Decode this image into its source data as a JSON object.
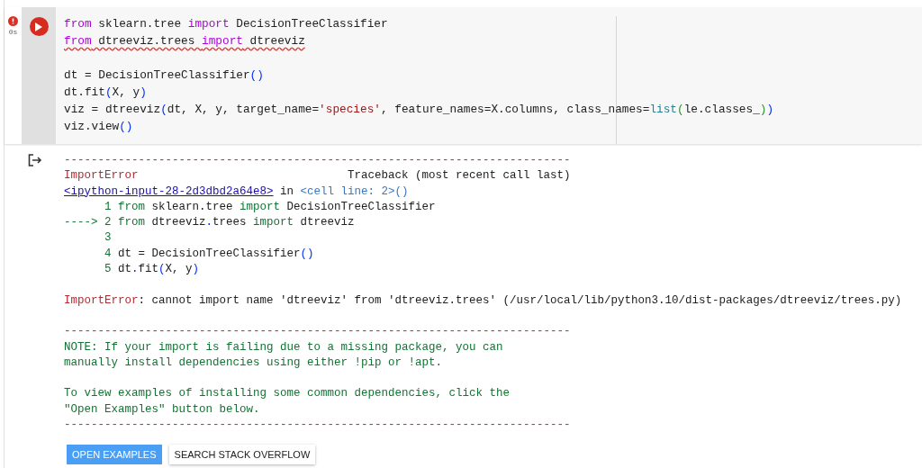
{
  "cell": {
    "error": true,
    "exec_time": "0s",
    "code_blocks": [
      [
        {
          "tokens": [
            {
              "text": "from",
              "kind": "kw"
            },
            {
              "text": " sklearn.tree ",
              "kind": "plain"
            },
            {
              "text": "import",
              "kind": "kw"
            },
            {
              "text": " DecisionTreeClassifier",
              "kind": "plain"
            }
          ],
          "error": false
        },
        {
          "error": true,
          "tokens": [
            {
              "text": "from",
              "kind": "kw"
            },
            {
              "text": " dtreeviz.trees ",
              "kind": "plain"
            },
            {
              "text": "import",
              "kind": "kw"
            },
            {
              "text": " dtreeviz",
              "kind": "plain"
            }
          ]
        }
      ],
      [
        {
          "error": false,
          "tokens": [
            {
              "text": "dt = DecisionTreeClassifier",
              "kind": "plain"
            },
            {
              "text": "()",
              "kind": "paren"
            }
          ]
        },
        {
          "error": false,
          "tokens": [
            {
              "text": "dt.fit",
              "kind": "plain"
            },
            {
              "text": "(",
              "kind": "paren"
            },
            {
              "text": "X, y",
              "kind": "plain"
            },
            {
              "text": ")",
              "kind": "paren"
            }
          ]
        },
        {
          "error": false,
          "tokens": [
            {
              "text": "viz = dtreeviz",
              "kind": "plain"
            },
            {
              "text": "(",
              "kind": "paren"
            },
            {
              "text": "dt, X, y, target_name=",
              "kind": "plain"
            },
            {
              "text": "'species'",
              "kind": "str"
            },
            {
              "text": ", feature_names=X.columns, class_names=",
              "kind": "plain"
            },
            {
              "text": "list",
              "kind": "builtin"
            },
            {
              "text": "(",
              "kind": "paren2"
            },
            {
              "text": "le.classes_",
              "kind": "plain"
            },
            {
              "text": ")",
              "kind": "paren2"
            },
            {
              "text": ")",
              "kind": "paren"
            }
          ]
        },
        {
          "error": false,
          "tokens": [
            {
              "text": "viz.view",
              "kind": "plain"
            },
            {
              "text": "()",
              "kind": "paren"
            }
          ]
        }
      ]
    ]
  },
  "output": {
    "blocks": [
      [
        [
          {
            "text": "---------------------------------------------------------------------------",
            "kind": "err"
          }
        ],
        [
          {
            "text": "ImportError",
            "kind": "err"
          },
          {
            "text": "                               Traceback (most recent call last)",
            "kind": "plain"
          }
        ],
        [
          {
            "text": "<ipython-input-28-2d3dbd2a64e8>",
            "kind": "link"
          },
          {
            "text": " in ",
            "kind": "plain"
          },
          {
            "text": "<cell line: 2>()",
            "kind": "cellref"
          }
        ],
        [
          {
            "text": "      1 ",
            "kind": "green"
          },
          {
            "text": "from",
            "kind": "green"
          },
          {
            "text": " sklearn.tree ",
            "kind": "plain"
          },
          {
            "text": "import",
            "kind": "green"
          },
          {
            "text": " DecisionTreeClassifier",
            "kind": "plain"
          }
        ],
        [
          {
            "text": "----> 2 ",
            "kind": "green"
          },
          {
            "text": "from",
            "kind": "green"
          },
          {
            "text": " dtreeviz",
            "kind": "plain"
          },
          {
            "text": ".",
            "kind": "paren"
          },
          {
            "text": "trees ",
            "kind": "plain"
          },
          {
            "text": "import",
            "kind": "green"
          },
          {
            "text": " dtreeviz",
            "kind": "plain"
          }
        ],
        [
          {
            "text": "      3",
            "kind": "green"
          }
        ],
        [
          {
            "text": "      4 ",
            "kind": "green"
          },
          {
            "text": "dt = DecisionTreeClassifier",
            "kind": "plain"
          },
          {
            "text": "()",
            "kind": "paren"
          }
        ],
        [
          {
            "text": "      5 ",
            "kind": "green"
          },
          {
            "text": "dt",
            "kind": "plain"
          },
          {
            "text": ".",
            "kind": "paren"
          },
          {
            "text": "fit",
            "kind": "plain"
          },
          {
            "text": "(",
            "kind": "paren"
          },
          {
            "text": "X, y",
            "kind": "plain"
          },
          {
            "text": ")",
            "kind": "paren"
          }
        ]
      ],
      [
        [
          {
            "text": "ImportError",
            "kind": "err"
          },
          {
            "text": ": cannot import name 'dtreeviz' from 'dtreeviz.trees' (/usr/local/lib/python3.10/dist-packages/dtreeviz/trees.py)",
            "kind": "plain"
          }
        ]
      ],
      [
        [
          {
            "text": "---------------------------------------------------------------------------",
            "kind": "err"
          }
        ],
        [
          {
            "text": "NOTE: If your import is failing due to a missing package, you can",
            "kind": "green"
          }
        ],
        [
          {
            "text": "manually install dependencies using either !pip or !apt.",
            "kind": "green"
          }
        ]
      ],
      [
        [
          {
            "text": "To view examples of installing some common dependencies, click the",
            "kind": "green"
          }
        ],
        [
          {
            "text": "\"Open Examples\" button below.",
            "kind": "green"
          }
        ],
        [
          {
            "text": "---------------------------------------------------------------------------",
            "kind": "err"
          }
        ]
      ]
    ],
    "buttons": [
      {
        "label": "OPEN EXAMPLES",
        "kind": "primary"
      },
      {
        "label": "SEARCH STACK OVERFLOW",
        "kind": "secondary"
      }
    ]
  }
}
